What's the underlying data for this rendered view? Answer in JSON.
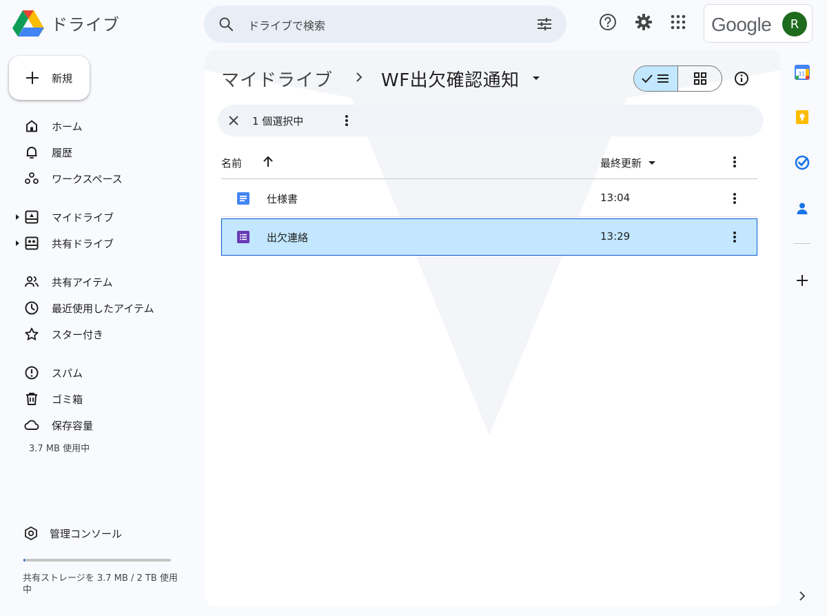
{
  "app": {
    "name": "ドライブ"
  },
  "search": {
    "placeholder": "ドライブで検索"
  },
  "account": {
    "brand": "Google",
    "avatar_letter": "R"
  },
  "sidebar": {
    "new_label": "新規",
    "items": [
      {
        "label": "ホーム",
        "icon": "home-icon"
      },
      {
        "label": "履歴",
        "icon": "bell-icon"
      },
      {
        "label": "ワークスペース",
        "icon": "workspace-icon"
      },
      {
        "label": "マイドライブ",
        "icon": "my-drive-icon"
      },
      {
        "label": "共有ドライブ",
        "icon": "shared-drive-icon"
      },
      {
        "label": "共有アイテム",
        "icon": "people-icon"
      },
      {
        "label": "最近使用したアイテム",
        "icon": "clock-icon"
      },
      {
        "label": "スター付き",
        "icon": "star-icon"
      },
      {
        "label": "スパム",
        "icon": "spam-icon"
      },
      {
        "label": "ゴミ箱",
        "icon": "trash-icon"
      },
      {
        "label": "保存容量",
        "icon": "cloud-icon"
      }
    ],
    "storage_used": "3.7 MB 使用中",
    "admin_label": "管理コンソール",
    "storage_fraction": 0.01,
    "storage_note": "共有ストレージを 3.7 MB / 2 TB 使用中"
  },
  "main": {
    "breadcrumb_root": "マイドライブ",
    "breadcrumb_current": "WF出欠確認通知",
    "selection_count": "1 個選択中",
    "columns": {
      "name": "名前",
      "modified": "最終更新"
    },
    "files": [
      {
        "name": "仕様書",
        "modified": "13:04",
        "type": "doc",
        "selected": false
      },
      {
        "name": "出欠連絡",
        "modified": "13:29",
        "type": "form",
        "selected": true
      }
    ]
  },
  "colors": {
    "accent": "#0b57d0",
    "selected_bg": "#c2e7ff",
    "doc_blue": "#4285f4",
    "form_purple": "#673ab7"
  }
}
